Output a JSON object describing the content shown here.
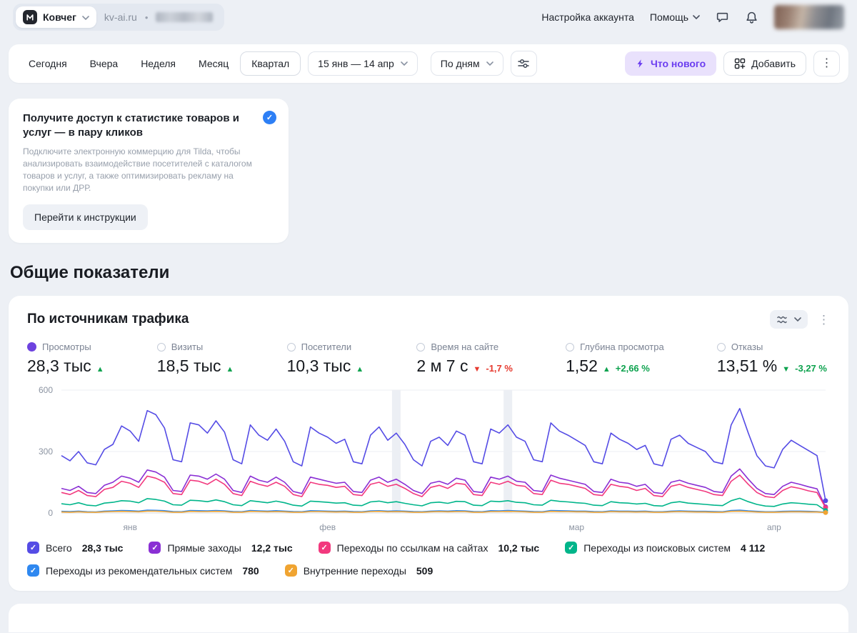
{
  "icons": {
    "kebab": "⋮",
    "check": "✓",
    "bullet": "•"
  },
  "header": {
    "counter_name": "Ковчег",
    "site": "kv-ai.ru",
    "separator": "•",
    "account_settings": "Настройка аккаунта",
    "help": "Помощь"
  },
  "toolbar": {
    "periods": [
      "Сегодня",
      "Вчера",
      "Неделя",
      "Месяц",
      "Квартал"
    ],
    "active_period": "Квартал",
    "date_range": "15 янв — 14 апр",
    "grouping": "По дням",
    "whats_new": "Что нового",
    "add": "Добавить"
  },
  "promo": {
    "title": "Получите доступ к статистике товаров и услуг — в пару кликов",
    "body": "Подключите электронную коммерцию для Tilda, чтобы анализировать взаимодействие посетителей с каталогом товаров и услуг, а также оптимизировать рекламу на покупки или ДРР.",
    "button": "Перейти к инструкции"
  },
  "section_title": "Общие показатели",
  "widget": {
    "title": "По источникам трафика",
    "metrics": [
      {
        "label": "Просмотры",
        "value": "28,3 тыс",
        "trend": "up",
        "trend_color": "#0da24e",
        "change": "",
        "change_color": "",
        "selected": true,
        "dot_color": "#6d42df"
      },
      {
        "label": "Визиты",
        "value": "18,5 тыс",
        "trend": "up",
        "trend_color": "#0da24e",
        "change": "",
        "change_color": "",
        "selected": false
      },
      {
        "label": "Посетители",
        "value": "10,3 тыс",
        "trend": "up",
        "trend_color": "#0da24e",
        "change": "",
        "change_color": "",
        "selected": false
      },
      {
        "label": "Время на сайте",
        "value": "2 м 7 с",
        "trend": "down",
        "trend_color": "#e6392e",
        "change": "-1,7 %",
        "change_color": "#e6392e",
        "selected": false
      },
      {
        "label": "Глубина просмотра",
        "value": "1,52",
        "trend": "up",
        "trend_color": "#0da24e",
        "change": "+2,66 %",
        "change_color": "#0da24e",
        "selected": false
      },
      {
        "label": "Отказы",
        "value": "13,51 %",
        "trend": "down",
        "trend_color": "#0da24e",
        "change": "-3,27 %",
        "change_color": "#0da24e",
        "selected": false
      }
    ]
  },
  "chart_data": {
    "type": "line",
    "title": "По источникам трафика",
    "date_range": "15 янв — 14 апр",
    "granularity": "По дням",
    "ylim": [
      0,
      600
    ],
    "yticks": [
      0,
      300,
      600
    ],
    "x_tick_labels": [
      "янв",
      "фев",
      "мар",
      "апр"
    ],
    "x_tick_indices": [
      8,
      31,
      60,
      83
    ],
    "holiday_band_indices": [
      39,
      52
    ],
    "legend_position": "bottom",
    "series": [
      {
        "name": "Всего",
        "total": "28,3 тыс",
        "color": "#554ce5",
        "values": [
          280,
          255,
          300,
          245,
          235,
          310,
          335,
          425,
          400,
          350,
          500,
          480,
          415,
          260,
          250,
          440,
          430,
          390,
          450,
          395,
          260,
          240,
          430,
          380,
          355,
          410,
          350,
          250,
          230,
          420,
          390,
          370,
          340,
          360,
          250,
          240,
          380,
          420,
          355,
          390,
          335,
          260,
          230,
          350,
          370,
          330,
          400,
          380,
          250,
          240,
          410,
          390,
          430,
          370,
          350,
          260,
          250,
          440,
          400,
          380,
          355,
          330,
          250,
          240,
          390,
          360,
          340,
          310,
          330,
          240,
          230,
          360,
          380,
          340,
          320,
          300,
          250,
          240,
          430,
          510,
          390,
          280,
          230,
          220,
          310,
          355,
          330,
          305,
          280,
          60
        ]
      },
      {
        "name": "Прямые заходы",
        "total": "12,2 тыс",
        "color": "#8a2fd4",
        "values": [
          120,
          110,
          130,
          100,
          95,
          135,
          150,
          180,
          170,
          150,
          210,
          200,
          175,
          110,
          105,
          185,
          180,
          165,
          190,
          165,
          110,
          100,
          180,
          160,
          150,
          175,
          150,
          105,
          95,
          175,
          165,
          155,
          145,
          150,
          105,
          100,
          160,
          175,
          150,
          165,
          140,
          110,
          95,
          145,
          155,
          140,
          170,
          160,
          105,
          100,
          175,
          165,
          180,
          155,
          150,
          110,
          105,
          185,
          170,
          160,
          150,
          140,
          105,
          100,
          165,
          150,
          145,
          130,
          140,
          100,
          95,
          150,
          160,
          145,
          135,
          125,
          105,
          100,
          180,
          215,
          165,
          120,
          95,
          90,
          130,
          150,
          140,
          128,
          118,
          30
        ]
      },
      {
        "name": "Переходы по ссылкам на сайтах",
        "total": "10,2 тыс",
        "color": "#f2397e",
        "values": [
          100,
          90,
          110,
          85,
          80,
          115,
          125,
          155,
          145,
          125,
          180,
          170,
          150,
          95,
          90,
          160,
          155,
          140,
          165,
          140,
          95,
          85,
          155,
          140,
          130,
          150,
          130,
          90,
          80,
          150,
          140,
          135,
          125,
          130,
          90,
          85,
          140,
          150,
          130,
          140,
          120,
          95,
          80,
          125,
          135,
          120,
          145,
          140,
          90,
          85,
          150,
          140,
          155,
          135,
          130,
          95,
          90,
          160,
          145,
          140,
          130,
          120,
          90,
          85,
          140,
          130,
          125,
          110,
          120,
          85,
          80,
          130,
          140,
          125,
          115,
          105,
          90,
          85,
          155,
          185,
          140,
          100,
          80,
          75,
          110,
          128,
          120,
          108,
          100,
          26
        ]
      },
      {
        "name": "Переходы из поисковых систем",
        "total": "4 112",
        "color": "#00b58a",
        "values": [
          45,
          40,
          50,
          38,
          35,
          48,
          52,
          60,
          58,
          50,
          70,
          66,
          58,
          40,
          38,
          62,
          60,
          55,
          64,
          55,
          40,
          36,
          60,
          55,
          50,
          58,
          50,
          38,
          34,
          58,
          55,
          52,
          48,
          50,
          38,
          36,
          54,
          58,
          50,
          55,
          47,
          40,
          35,
          50,
          53,
          47,
          57,
          55,
          38,
          36,
          58,
          55,
          60,
          52,
          50,
          40,
          38,
          62,
          57,
          54,
          50,
          47,
          38,
          36,
          55,
          50,
          48,
          44,
          47,
          36,
          34,
          50,
          55,
          48,
          45,
          42,
          38,
          36,
          60,
          72,
          55,
          42,
          34,
          32,
          44,
          50,
          47,
          43,
          40,
          12
        ]
      },
      {
        "name": "Переходы из рекомендательных систем",
        "total": "780",
        "color": "#2f88f0",
        "values": [
          8,
          7,
          9,
          6,
          5,
          9,
          10,
          12,
          11,
          9,
          14,
          13,
          11,
          7,
          6,
          12,
          11,
          10,
          12,
          10,
          7,
          6,
          12,
          10,
          9,
          11,
          9,
          7,
          6,
          11,
          10,
          9,
          8,
          9,
          7,
          6,
          10,
          11,
          9,
          10,
          9,
          7,
          6,
          9,
          10,
          9,
          11,
          10,
          7,
          6,
          11,
          10,
          12,
          10,
          9,
          7,
          6,
          12,
          11,
          10,
          9,
          9,
          7,
          6,
          10,
          9,
          9,
          8,
          9,
          6,
          6,
          9,
          10,
          9,
          8,
          8,
          7,
          6,
          12,
          14,
          10,
          8,
          6,
          6,
          8,
          9,
          9,
          8,
          7,
          3
        ]
      },
      {
        "name": "Внутренние переходы",
        "total": "509",
        "color": "#f0a431",
        "values": [
          5,
          4,
          6,
          4,
          3,
          6,
          7,
          8,
          7,
          6,
          9,
          9,
          7,
          4,
          4,
          8,
          7,
          7,
          8,
          7,
          4,
          4,
          8,
          7,
          6,
          7,
          6,
          4,
          4,
          7,
          7,
          6,
          5,
          6,
          4,
          4,
          7,
          8,
          6,
          7,
          6,
          4,
          4,
          6,
          7,
          6,
          7,
          7,
          4,
          4,
          7,
          7,
          8,
          7,
          6,
          4,
          4,
          8,
          7,
          7,
          6,
          6,
          4,
          4,
          7,
          6,
          6,
          5,
          6,
          4,
          4,
          6,
          7,
          6,
          5,
          5,
          4,
          4,
          8,
          9,
          7,
          5,
          4,
          4,
          5,
          6,
          6,
          5,
          5,
          2
        ]
      }
    ]
  }
}
